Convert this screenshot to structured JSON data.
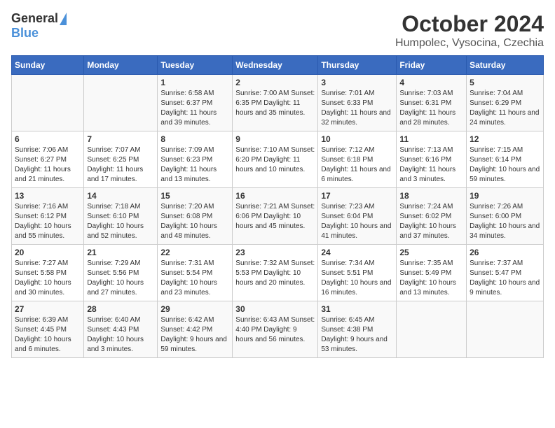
{
  "logo": {
    "general": "General",
    "blue": "Blue"
  },
  "title": "October 2024",
  "subtitle": "Humpolec, Vysocina, Czechia",
  "days_of_week": [
    "Sunday",
    "Monday",
    "Tuesday",
    "Wednesday",
    "Thursday",
    "Friday",
    "Saturday"
  ],
  "weeks": [
    [
      {
        "day": "",
        "info": ""
      },
      {
        "day": "",
        "info": ""
      },
      {
        "day": "1",
        "info": "Sunrise: 6:58 AM\nSunset: 6:37 PM\nDaylight: 11 hours and 39 minutes."
      },
      {
        "day": "2",
        "info": "Sunrise: 7:00 AM\nSunset: 6:35 PM\nDaylight: 11 hours and 35 minutes."
      },
      {
        "day": "3",
        "info": "Sunrise: 7:01 AM\nSunset: 6:33 PM\nDaylight: 11 hours and 32 minutes."
      },
      {
        "day": "4",
        "info": "Sunrise: 7:03 AM\nSunset: 6:31 PM\nDaylight: 11 hours and 28 minutes."
      },
      {
        "day": "5",
        "info": "Sunrise: 7:04 AM\nSunset: 6:29 PM\nDaylight: 11 hours and 24 minutes."
      }
    ],
    [
      {
        "day": "6",
        "info": "Sunrise: 7:06 AM\nSunset: 6:27 PM\nDaylight: 11 hours and 21 minutes."
      },
      {
        "day": "7",
        "info": "Sunrise: 7:07 AM\nSunset: 6:25 PM\nDaylight: 11 hours and 17 minutes."
      },
      {
        "day": "8",
        "info": "Sunrise: 7:09 AM\nSunset: 6:23 PM\nDaylight: 11 hours and 13 minutes."
      },
      {
        "day": "9",
        "info": "Sunrise: 7:10 AM\nSunset: 6:20 PM\nDaylight: 11 hours and 10 minutes."
      },
      {
        "day": "10",
        "info": "Sunrise: 7:12 AM\nSunset: 6:18 PM\nDaylight: 11 hours and 6 minutes."
      },
      {
        "day": "11",
        "info": "Sunrise: 7:13 AM\nSunset: 6:16 PM\nDaylight: 11 hours and 3 minutes."
      },
      {
        "day": "12",
        "info": "Sunrise: 7:15 AM\nSunset: 6:14 PM\nDaylight: 10 hours and 59 minutes."
      }
    ],
    [
      {
        "day": "13",
        "info": "Sunrise: 7:16 AM\nSunset: 6:12 PM\nDaylight: 10 hours and 55 minutes."
      },
      {
        "day": "14",
        "info": "Sunrise: 7:18 AM\nSunset: 6:10 PM\nDaylight: 10 hours and 52 minutes."
      },
      {
        "day": "15",
        "info": "Sunrise: 7:20 AM\nSunset: 6:08 PM\nDaylight: 10 hours and 48 minutes."
      },
      {
        "day": "16",
        "info": "Sunrise: 7:21 AM\nSunset: 6:06 PM\nDaylight: 10 hours and 45 minutes."
      },
      {
        "day": "17",
        "info": "Sunrise: 7:23 AM\nSunset: 6:04 PM\nDaylight: 10 hours and 41 minutes."
      },
      {
        "day": "18",
        "info": "Sunrise: 7:24 AM\nSunset: 6:02 PM\nDaylight: 10 hours and 37 minutes."
      },
      {
        "day": "19",
        "info": "Sunrise: 7:26 AM\nSunset: 6:00 PM\nDaylight: 10 hours and 34 minutes."
      }
    ],
    [
      {
        "day": "20",
        "info": "Sunrise: 7:27 AM\nSunset: 5:58 PM\nDaylight: 10 hours and 30 minutes."
      },
      {
        "day": "21",
        "info": "Sunrise: 7:29 AM\nSunset: 5:56 PM\nDaylight: 10 hours and 27 minutes."
      },
      {
        "day": "22",
        "info": "Sunrise: 7:31 AM\nSunset: 5:54 PM\nDaylight: 10 hours and 23 minutes."
      },
      {
        "day": "23",
        "info": "Sunrise: 7:32 AM\nSunset: 5:53 PM\nDaylight: 10 hours and 20 minutes."
      },
      {
        "day": "24",
        "info": "Sunrise: 7:34 AM\nSunset: 5:51 PM\nDaylight: 10 hours and 16 minutes."
      },
      {
        "day": "25",
        "info": "Sunrise: 7:35 AM\nSunset: 5:49 PM\nDaylight: 10 hours and 13 minutes."
      },
      {
        "day": "26",
        "info": "Sunrise: 7:37 AM\nSunset: 5:47 PM\nDaylight: 10 hours and 9 minutes."
      }
    ],
    [
      {
        "day": "27",
        "info": "Sunrise: 6:39 AM\nSunset: 4:45 PM\nDaylight: 10 hours and 6 minutes."
      },
      {
        "day": "28",
        "info": "Sunrise: 6:40 AM\nSunset: 4:43 PM\nDaylight: 10 hours and 3 minutes."
      },
      {
        "day": "29",
        "info": "Sunrise: 6:42 AM\nSunset: 4:42 PM\nDaylight: 9 hours and 59 minutes."
      },
      {
        "day": "30",
        "info": "Sunrise: 6:43 AM\nSunset: 4:40 PM\nDaylight: 9 hours and 56 minutes."
      },
      {
        "day": "31",
        "info": "Sunrise: 6:45 AM\nSunset: 4:38 PM\nDaylight: 9 hours and 53 minutes."
      },
      {
        "day": "",
        "info": ""
      },
      {
        "day": "",
        "info": ""
      }
    ]
  ]
}
